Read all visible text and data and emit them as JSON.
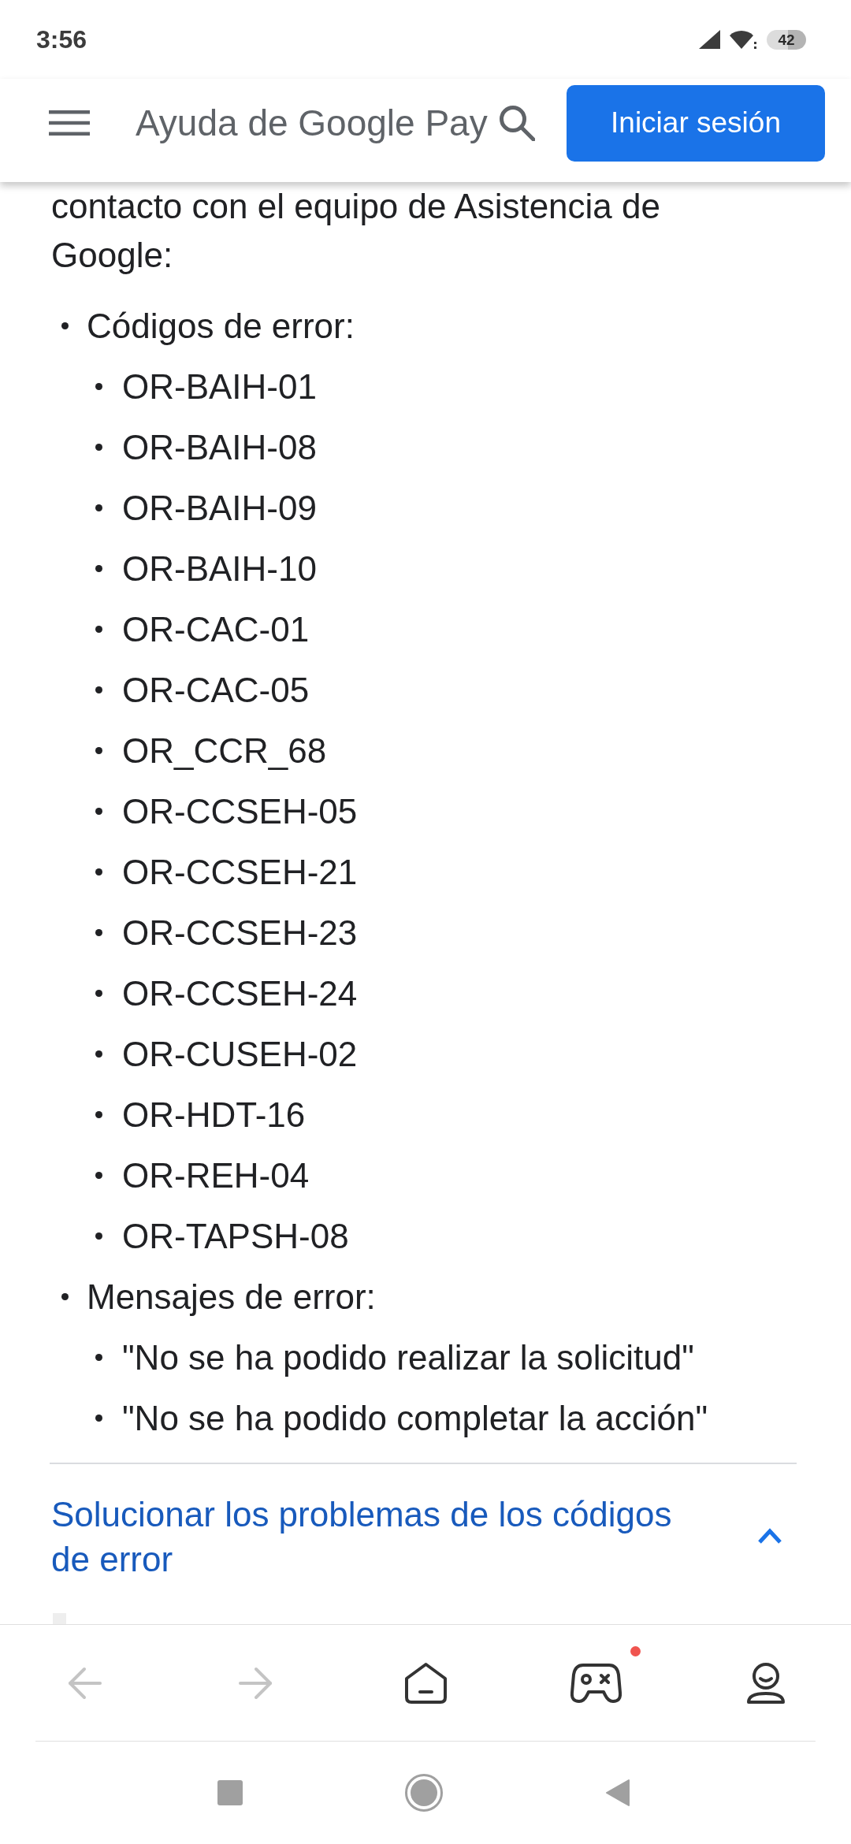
{
  "status_bar": {
    "time": "3:56",
    "battery": "42"
  },
  "header": {
    "title": "Ayuda de Google Pay",
    "sign_in_button": "Iniciar sesión"
  },
  "article": {
    "intro": "contacto con el equipo de Asistencia de Google:",
    "list": [
      {
        "text": "Códigos de error:",
        "children": [
          {
            "text": "OR-BAIH-01"
          },
          {
            "text": "OR-BAIH-08"
          },
          {
            "text": "OR-BAIH-09"
          },
          {
            "text": "OR-BAIH-10"
          },
          {
            "text": "OR-CAC-01"
          },
          {
            "text": "OR-CAC-05"
          },
          {
            "text": "OR_CCR_68"
          },
          {
            "text": "OR-CCSEH-05"
          },
          {
            "text": "OR-CCSEH-21"
          },
          {
            "text": "OR-CCSEH-23"
          },
          {
            "text": "OR-CCSEH-24"
          },
          {
            "text": "OR-CUSEH-02"
          },
          {
            "text": "OR-HDT-16"
          },
          {
            "text": "OR-REH-04"
          },
          {
            "text": "OR-TAPSH-08"
          }
        ]
      },
      {
        "text": "Mensajes de error:",
        "children": [
          {
            "text": "\"No se ha podido realizar la solicitud\""
          },
          {
            "text": "\"No se ha podido completar la acción\""
          }
        ]
      }
    ]
  },
  "accordion": {
    "title": "Solucionar los problemas de los códigos de error",
    "expanded": true
  },
  "browser_nav": [
    {
      "kind": "back",
      "disabled": true,
      "notification": false
    },
    {
      "kind": "forward",
      "disabled": true,
      "notification": false
    },
    {
      "kind": "home",
      "disabled": false,
      "notification": false
    },
    {
      "kind": "games",
      "disabled": false,
      "notification": true
    },
    {
      "kind": "profile",
      "disabled": false,
      "notification": false
    }
  ],
  "system_nav": [
    {
      "kind": "recents"
    },
    {
      "kind": "home"
    },
    {
      "kind": "back"
    }
  ]
}
